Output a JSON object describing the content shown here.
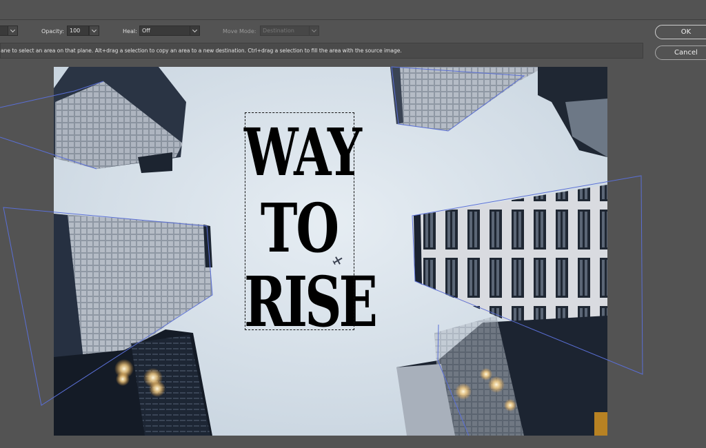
{
  "options": {
    "opacity_label": "Opacity:",
    "opacity_value": "100",
    "heal_label": "Heal:",
    "heal_value": "Off",
    "move_mode_label": "Move Mode:",
    "move_mode_value": "Destination"
  },
  "hint": "ane to select an area on that plane. Alt+drag a selection to copy an area to a new destination. Ctrl+drag a selection to fill the area with the source image.",
  "buttons": {
    "ok": "OK",
    "cancel": "Cancel"
  },
  "image_text": {
    "line1": "WAY",
    "line2": "TO",
    "line3": "RISE"
  },
  "colors": {
    "workspace": "#535353",
    "plane_grid": "#5a6fd6",
    "sky": "#d9e3ec"
  },
  "icons": {
    "dropdown": "chevron-down-icon",
    "airplane": "airplane-icon"
  }
}
